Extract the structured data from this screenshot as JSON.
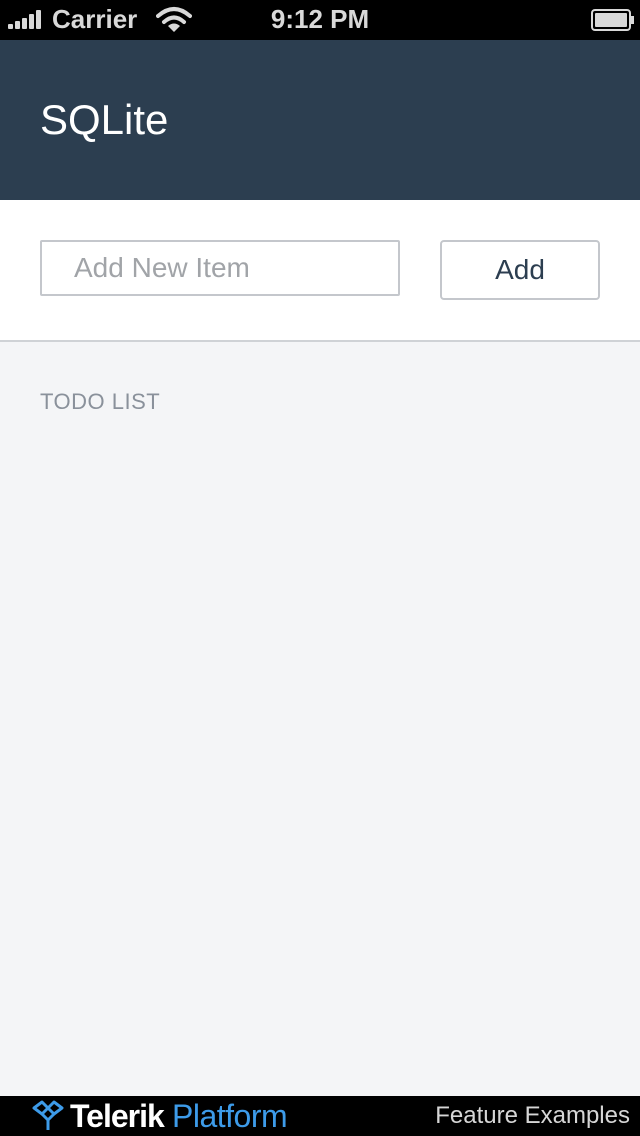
{
  "status_bar": {
    "carrier": "Carrier",
    "time": "9:12 PM",
    "signal_icon": "signal-bars-icon",
    "wifi_icon": "wifi-icon",
    "battery_icon": "battery-icon"
  },
  "header": {
    "title": "SQLite",
    "background_color": "#2c3e50"
  },
  "input_section": {
    "input_value": "",
    "input_placeholder": "Add New Item",
    "add_label": "Add"
  },
  "list": {
    "heading": "TODO LIST",
    "items": []
  },
  "footer": {
    "logo_icon": "telerik-logo-icon",
    "brand_name": "Telerik",
    "brand_product": "Platform",
    "link_label": "Feature Examples",
    "accent_color": "#3d9be9"
  }
}
